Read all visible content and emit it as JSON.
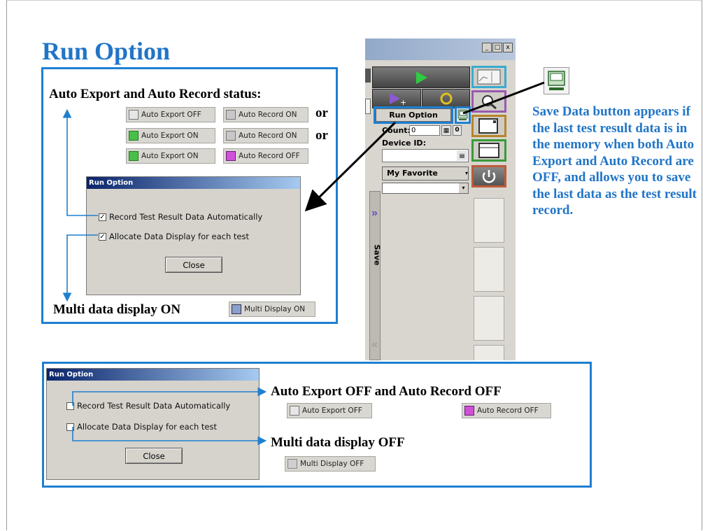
{
  "slide": {
    "title": "Run Option"
  },
  "top_panel": {
    "status_heading": "Auto Export and Auto Record status:",
    "or_label": "or",
    "status_rows": [
      {
        "export_label": "Auto Export OFF",
        "record_label": "Auto Record ON"
      },
      {
        "export_label": "Auto Export ON",
        "record_label": "Auto Record ON"
      },
      {
        "export_label": "Auto Export ON",
        "record_label": "Auto Record OFF"
      }
    ],
    "dialog": {
      "title": "Run Option",
      "option1_label": "Record Test Result Data Automatically",
      "option1_checked": true,
      "option2_label": "Allocate Data Display for each test",
      "option2_checked": true,
      "close_label": "Close"
    },
    "multi_label": "Multi data display ON",
    "multi_button_label": "Multi Display ON"
  },
  "app": {
    "win_buttons": [
      "_",
      "□",
      "x"
    ],
    "run_option_label": "Run Option",
    "count_label": "Count:",
    "count_value": "0",
    "count_suffix": "0",
    "device_id_label": "Device ID:",
    "device_id_value": "",
    "setup_label": "My Favorite Setup",
    "side_tab_label": "Save",
    "side_chevron_top": "»",
    "side_chevron_bottom": "«"
  },
  "save_callout": {
    "text": "Save Data button appears if the last test result data is in the memory when both Auto Export and Auto Record are OFF, and allows you to save the last data as the test result record."
  },
  "bottom_panel": {
    "dialog": {
      "title": "Run Option",
      "option1_label": "Record Test Result Data Automatically",
      "option1_checked": false,
      "option2_label": "Allocate Data Display for each test",
      "option2_checked": false,
      "close_label": "Close"
    },
    "off_heading": "Auto Export OFF and Auto Record OFF",
    "export_label": "Auto Export OFF",
    "record_label": "Auto Record OFF",
    "multi_off_heading": "Multi data display OFF",
    "multi_off_button_label": "Multi Display OFF"
  },
  "colors": {
    "accent": "#1e7fd0",
    "title": "#2175c7"
  }
}
